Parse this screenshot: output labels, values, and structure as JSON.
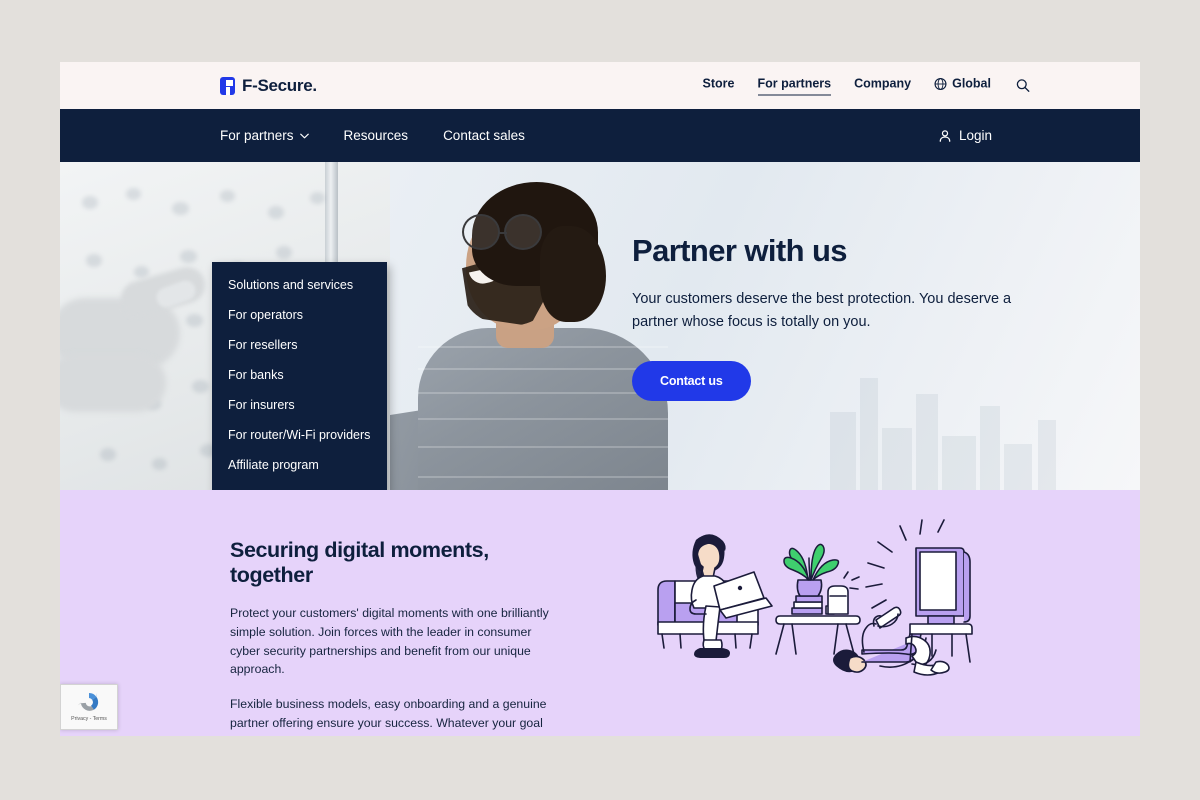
{
  "brand": {
    "name": "F-Secure",
    "trademark": "."
  },
  "utility_nav": {
    "links": [
      {
        "label": "Store",
        "active": false
      },
      {
        "label": "For partners",
        "active": true
      },
      {
        "label": "Company",
        "active": false
      }
    ],
    "global_label": "Global",
    "globe_icon": "globe-icon",
    "search_icon": "search-icon"
  },
  "main_nav": {
    "links": [
      {
        "label": "For partners",
        "has_chevron": true
      },
      {
        "label": "Resources",
        "has_chevron": false
      },
      {
        "label": "Contact sales",
        "has_chevron": false
      }
    ],
    "login_label": "Login",
    "login_icon": "user-icon",
    "chevron_icon": "chevron-down-icon"
  },
  "dropdown": {
    "items": [
      "Solutions and services",
      "For operators",
      "For resellers",
      "For banks",
      "For insurers",
      "For router/Wi-Fi providers",
      "Affiliate program"
    ]
  },
  "hero": {
    "title": "Partner with us",
    "subtitle": "Your customers deserve the best protection. You deserve a partner whose focus is totally on you.",
    "cta_label": "Contact us",
    "cta_color": "#2139E8",
    "image_left_alt": "hand-pointing-at-whiteboard-photo",
    "image_right_alt": "smiling-man-with-glasses-photo"
  },
  "section_purple": {
    "background": "#E6D3FA",
    "title": "Securing digital moments, together",
    "paragraphs": [
      "Protect your customers' digital moments with one brilliantly simple solution. Join forces with the leader in consumer cyber security partnerships and benefit from our unique approach.",
      "Flexible business models, easy onboarding and a genuine partner offering ensure your success. Whatever your goal is, ours is to help you achieve it."
    ],
    "illustration_alt": "people-using-connected-devices-at-home-illustration"
  },
  "recaptcha": {
    "text": "Privacy - Terms",
    "icon": "recaptcha-icon"
  },
  "theme": {
    "navy": "#0E1F3D",
    "blue": "#2139E8",
    "purple": "#E6D3FA",
    "utility_bar": "#FAF4F3",
    "page_backdrop": "#E3E0DC"
  }
}
